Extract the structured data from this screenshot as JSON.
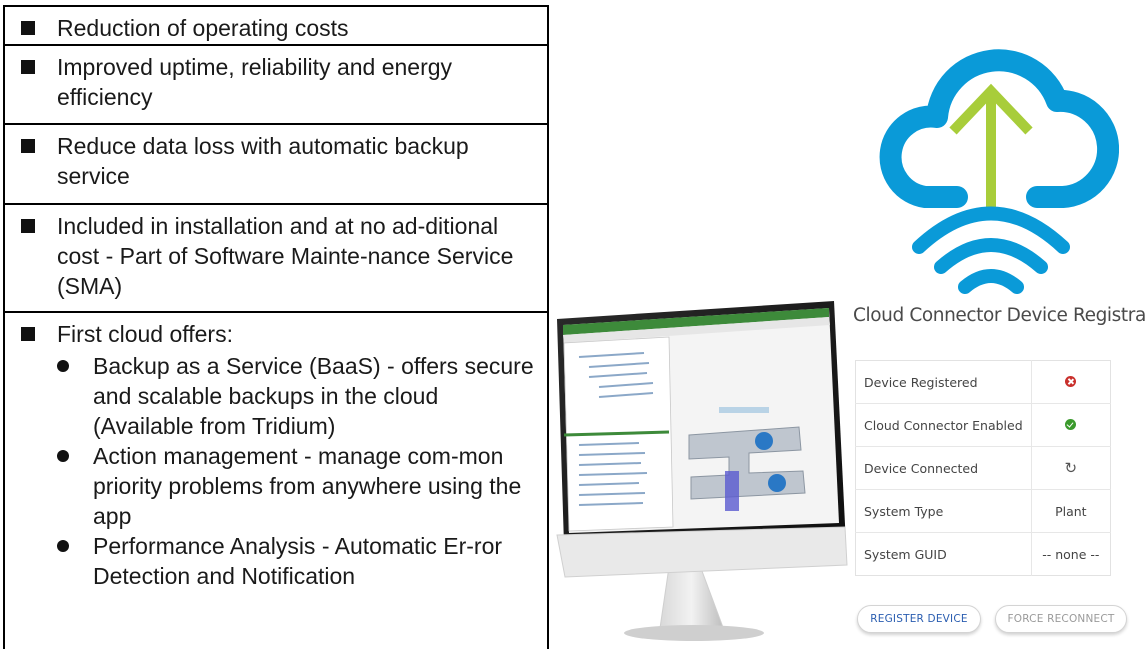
{
  "bullets": [
    {
      "text": "Reduction of operating costs"
    },
    {
      "text": "Improved uptime, reliability and energy efficiency"
    },
    {
      "text": "Reduce data loss with automatic backup service"
    },
    {
      "text": "Included in installation and at no ad-ditional cost - Part of Software Mainte-nance Service (SMA)"
    },
    {
      "text": "First cloud offers:",
      "sub": [
        "Backup as a Service (BaaS) - offers secure and scalable backups in the cloud (Available from Tridium)",
        "Action management - manage com-mon priority problems from anywhere using the app",
        "Performance Analysis - Automatic Er-ror Detection and Notification"
      ]
    }
  ],
  "panel": {
    "title": "Cloud Connector Device Registration",
    "rows": [
      {
        "label": "Device Registered",
        "value": "",
        "icon": "error-x-icon"
      },
      {
        "label": "Cloud Connector Enabled",
        "value": "",
        "icon": "check-icon"
      },
      {
        "label": "Device Connected",
        "value": "",
        "icon": "refresh-icon"
      },
      {
        "label": "System Type",
        "value": "Plant"
      },
      {
        "label": "System GUID",
        "value": "-- none --"
      }
    ],
    "register_button": "REGISTER DEVICE",
    "reconnect_button": "FORCE RECONNECT"
  },
  "colors": {
    "cloud_blue": "#0a9ad8",
    "arrow_green": "#a8cd3a",
    "error_red": "#c9302c",
    "ok_green": "#3a9a2c",
    "link_blue": "#2a5db0"
  },
  "icons": [
    "cloud-upload-icon",
    "wifi-icon",
    "monitor-screenshot"
  ]
}
